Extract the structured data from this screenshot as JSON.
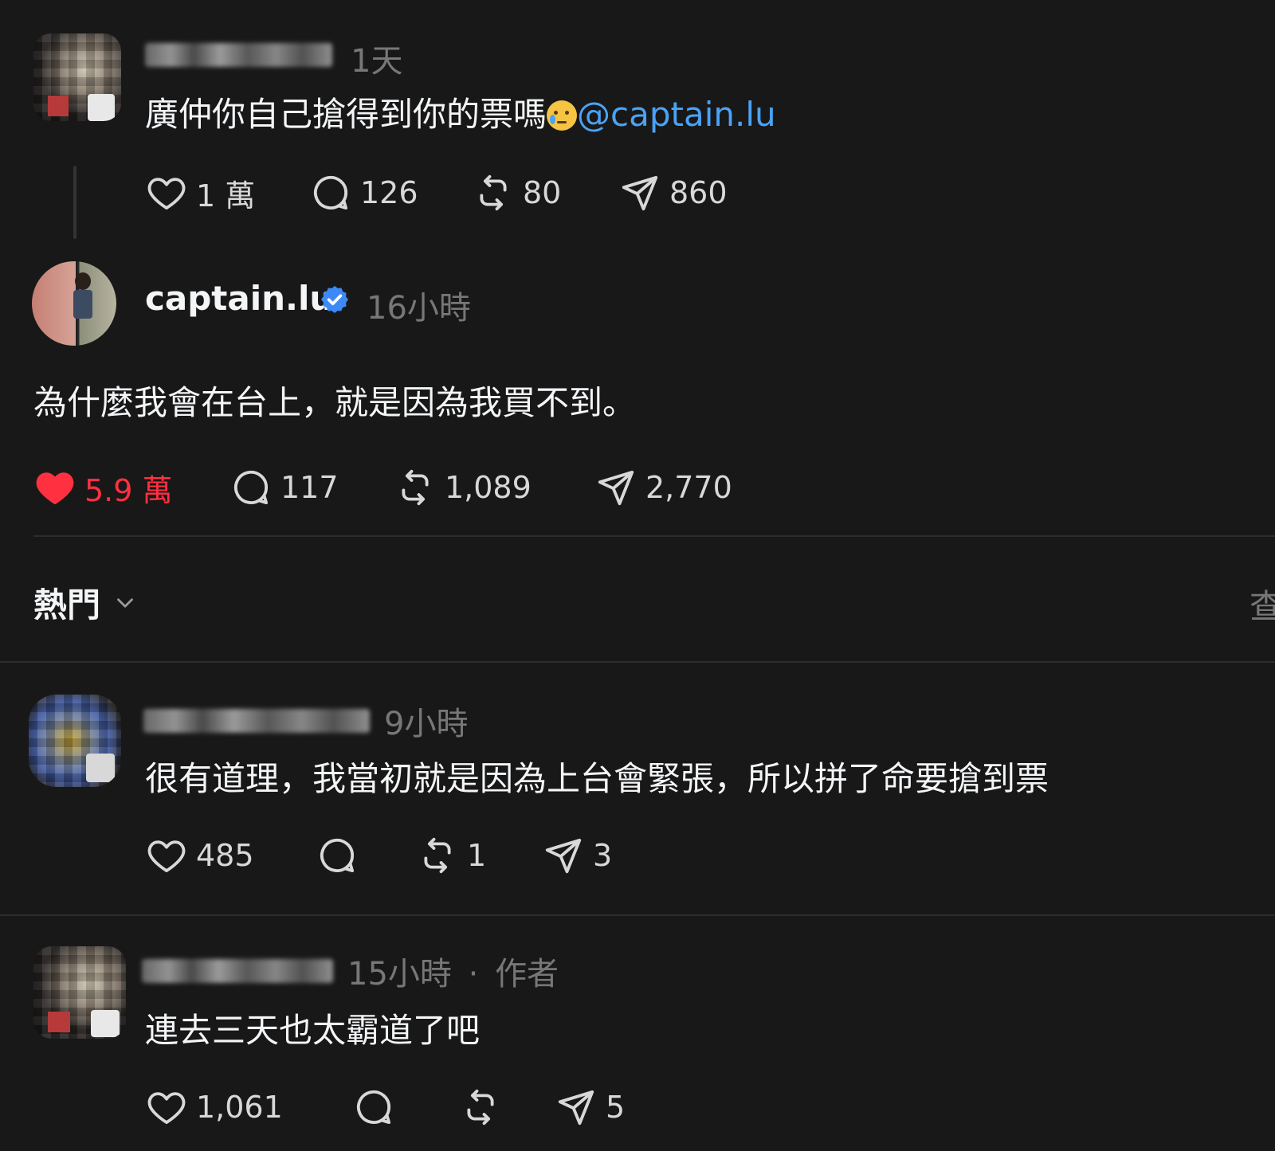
{
  "parent_post": {
    "time": "1天",
    "text": "廣仲你自己搶得到你的票嗎",
    "mention": "@captain.lu",
    "likes": "1 萬",
    "replies": "126",
    "reposts": "80",
    "shares": "860"
  },
  "main_post": {
    "username": "captain.lu",
    "time": "16小時",
    "text": "為什麼我會在台上，就是因為我買不到。",
    "likes": "5.9 萬",
    "replies": "117",
    "reposts": "1,089",
    "shares": "2,770",
    "liked": true,
    "colors": {
      "liked": "#ff3040",
      "verified": "#3d8af7",
      "mention": "#4aa3f5"
    }
  },
  "sort": {
    "label": "熱門",
    "right_partial": "查"
  },
  "replies": [
    {
      "time": "9小時",
      "text": "很有道理，我當初就是因為上台會緊張，所以拼了命要搶到票",
      "likes": "485",
      "replies": "",
      "reposts": "1",
      "shares": "3"
    },
    {
      "time": "15小時",
      "meta_sep": "·",
      "author_tag": "作者",
      "text": "連去三天也太霸道了吧",
      "likes": "1,061",
      "replies": "",
      "reposts": "",
      "shares": "5"
    }
  ]
}
